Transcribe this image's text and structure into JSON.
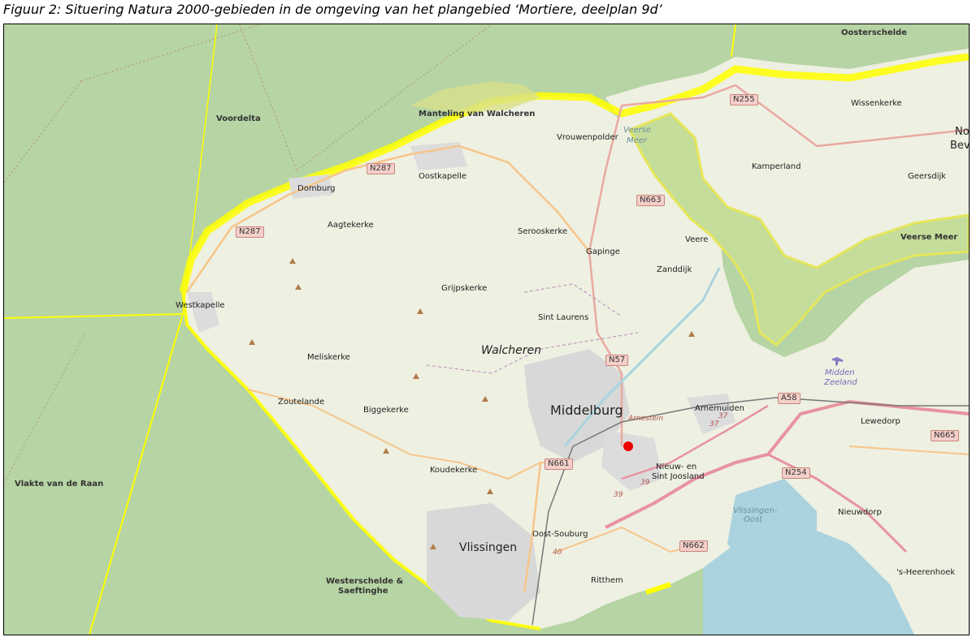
{
  "caption": "Figuur 2: Situering Natura 2000-gebieden in de omgeving van het plangebied ‘Mortiere, deelplan 9d’",
  "colors": {
    "sea": "#b6d4a4",
    "land": "#eef0e2",
    "natura": "#ffff00",
    "motorway": "#e892a2",
    "primary": "#fcd6a4",
    "urban": "#d8d8d8",
    "water": "#aad3df",
    "marker": "#ee0000"
  },
  "natura_areas": {
    "oosterschelde": "Oosterschelde",
    "voordelta": "Voordelta",
    "manteling": "Manteling van Walcheren",
    "veerse_meer": "Veerse Meer",
    "vlakte_van_de_raan": "Vlakte van de Raan",
    "westerschelde_1": "Westerschelde &",
    "westerschelde_2": "Saeftinghe"
  },
  "places": {
    "domburg": "Domburg",
    "oostkapelle": "Oostkapelle",
    "vrouwenpolder": "Vrouwenpolder",
    "aagtekerke": "Aagtekerke",
    "serooskerke": "Serooskerke",
    "gapinge": "Gapinge",
    "grijpskerke": "Grijpskerke",
    "westkapelle": "Westkapelle",
    "sint_laurens": "Sint Laurens",
    "meliskerke": "Meliskerke",
    "walcheren": "Walcheren",
    "zoutelande": "Zoutelande",
    "biggekerke": "Biggekerke",
    "middelburg": "Middelburg",
    "arnemuiden": "Arnemuiden",
    "arnestein": "Arnestein",
    "nieuw_sint_joosland_1": "Nieuw- en",
    "nieuw_sint_joosland_2": "Sint Joosland",
    "koudekerke": "Koudekerke",
    "vlissingen": "Vlissingen",
    "oost_souburg": "Oost-Souburg",
    "ritthem": "Ritthem",
    "veere": "Veere",
    "zanddijk": "Zanddijk",
    "kamperland": "Kamperland",
    "wissenkerke": "Wissenkerke",
    "geersdijk": "Geersdijk",
    "lewedorp": "Lewedorp",
    "nieuwdorp": "Nieuwdorp",
    "s_heerenhoek": "'s-Heerenhoek",
    "noord_beveland_1": "No",
    "noord_beveland_2": "Bev",
    "veerse_meer_water_1": "Veerse",
    "veerse_meer_water_2": "Meer",
    "vlissingen_oost_1": "Vlissingen-",
    "vlissingen_oost_2": "Oost",
    "midden_zeeland_1": "Midden",
    "midden_zeeland_2": "Zeeland"
  },
  "roads": {
    "n287_a": "N287",
    "n287_b": "N287",
    "n255": "N255",
    "n663": "N663",
    "n57": "N57",
    "a58": "A58",
    "n665": "N665",
    "n661": "N661",
    "n254": "N254",
    "n662": "N662"
  },
  "exits": {
    "e37a": "37",
    "e37b": "37",
    "e39a": "39",
    "e39b": "39",
    "e40": "40"
  },
  "plan_location_marker": "plangebied"
}
